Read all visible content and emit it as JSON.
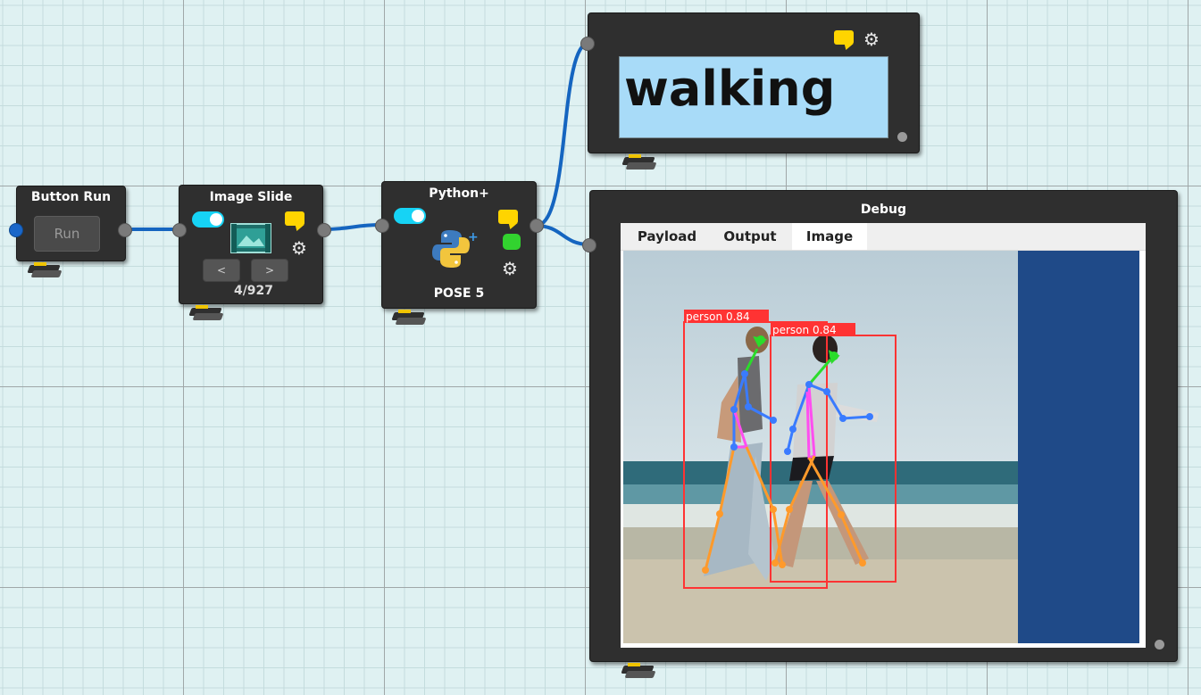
{
  "nodes": {
    "button_run": {
      "title": "Button Run",
      "button_label": "Run"
    },
    "image_slide": {
      "title": "Image Slide",
      "prev_label": "<",
      "next_label": ">",
      "counter": "4/927"
    },
    "python_plus": {
      "title": "Python+",
      "label": "POSE 5"
    },
    "text_output": {
      "text": "walking"
    },
    "debug": {
      "title": "Debug",
      "tabs": [
        "Payload",
        "Output",
        "Image"
      ],
      "active_tab": "Image",
      "detections": [
        {
          "label": "person  0.84"
        },
        {
          "label": "person  0.84"
        }
      ]
    }
  },
  "colors": {
    "wire": "#1565c0",
    "toggle": "#16d3f5",
    "comment": "#ffd400",
    "status_ok": "#32d32f",
    "bbox": "#ff3333",
    "side_panel": "#1f4a88"
  },
  "icons": [
    "comment-icon",
    "gear-icon",
    "image-icon",
    "python-icon",
    "toggle-icon",
    "folder-icon"
  ]
}
